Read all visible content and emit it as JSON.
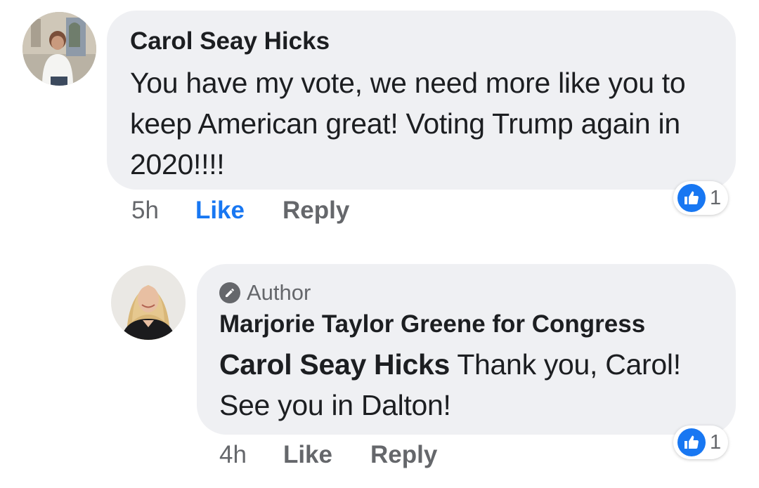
{
  "comments": [
    {
      "author": "Carol Seay Hicks",
      "text": "You have my vote, we need more like you to keep American great!  Voting Trump again in 2020!!!!",
      "time": "5h",
      "like_label": "Like",
      "reply_label": "Reply",
      "reaction_count": "1",
      "liked": true
    },
    {
      "badge": "Author",
      "author": "Marjorie Taylor Greene for Congress",
      "mention": "Carol Seay Hicks",
      "text": "Thank you, Carol! See you in Dalton!",
      "time": "4h",
      "like_label": "Like",
      "reply_label": "Reply",
      "reaction_count": "1",
      "liked": false
    }
  ],
  "colors": {
    "bubble": "#eff0f3",
    "accent": "#1877f2",
    "muted": "#65676b",
    "text": "#1c1e21"
  },
  "icons": [
    "profile-photo",
    "pencil-icon",
    "thumbs-up-icon"
  ]
}
